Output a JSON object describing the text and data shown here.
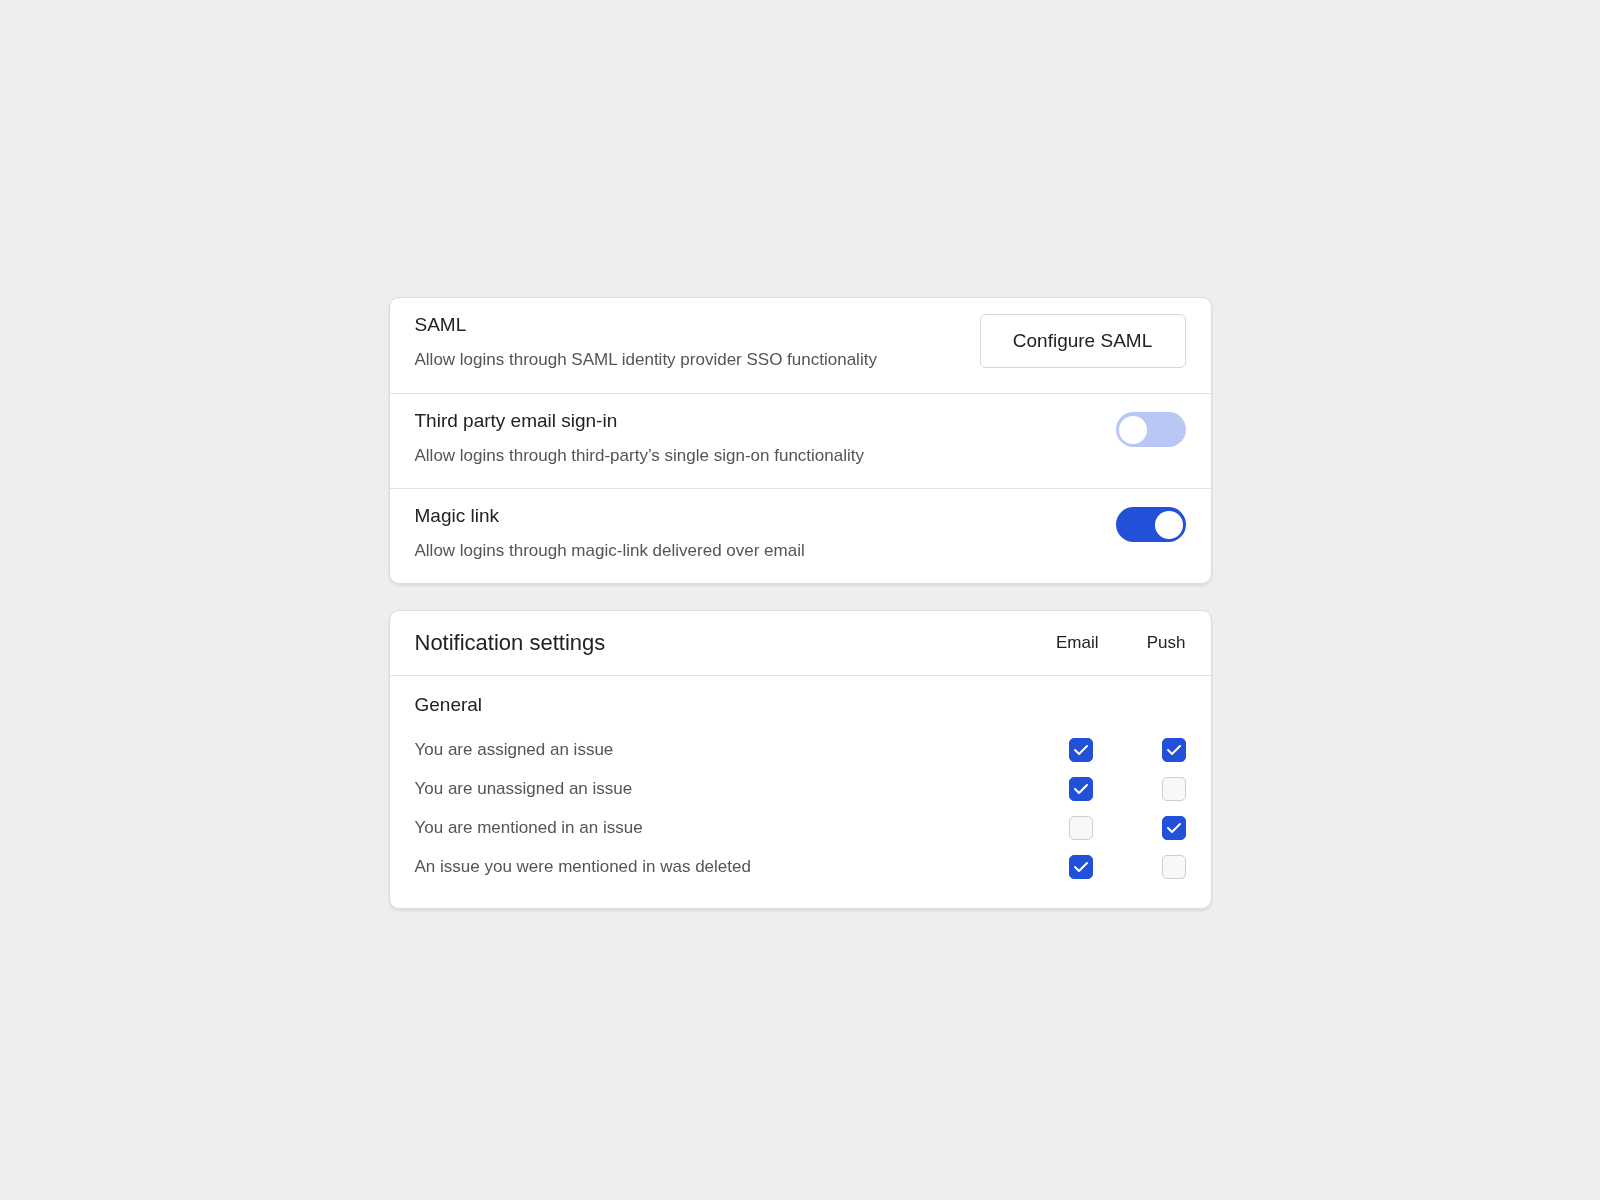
{
  "login_methods": [
    {
      "kind": "button",
      "title": "SAML",
      "description": "Allow logins through SAML identity provider SSO functionality",
      "button": "Configure SAML"
    },
    {
      "kind": "toggle",
      "title": "Third party email sign-in",
      "description": "Allow logins through third-party’s single sign-on functionality",
      "on": false
    },
    {
      "kind": "toggle",
      "title": "Magic link",
      "description": "Allow logins through magic-link delivered over email",
      "on": true
    }
  ],
  "notifications": {
    "title": "Notification settings",
    "columns": [
      "Email",
      "Push"
    ],
    "section": "General",
    "rows": [
      {
        "label": "You are assigned an issue",
        "email": true,
        "push": true
      },
      {
        "label": "You are unassigned an issue",
        "email": true,
        "push": false
      },
      {
        "label": "You are mentioned in an issue",
        "email": false,
        "push": true
      },
      {
        "label": "An issue you were mentioned in was deleted",
        "email": true,
        "push": false
      }
    ]
  }
}
